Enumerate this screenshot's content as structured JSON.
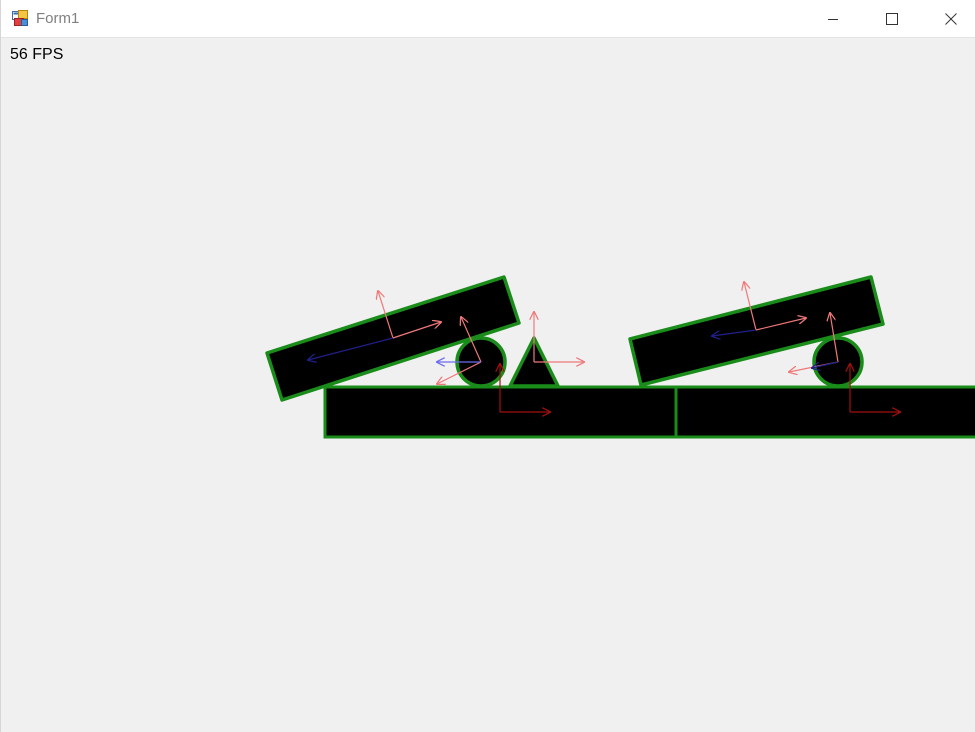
{
  "window": {
    "title": "Form1",
    "icon": "winforms-app-icon",
    "buttons": [
      "minimize-icon",
      "maximize-icon",
      "close-icon"
    ]
  },
  "client": {
    "fps_text": "56 FPS"
  },
  "scene": {
    "body_fill": "#000000",
    "outline_color": "#1a8c1a",
    "axis_color": "#f08080",
    "axis_dark_color": "#8b0000",
    "velocity_color": "#7070f0"
  }
}
